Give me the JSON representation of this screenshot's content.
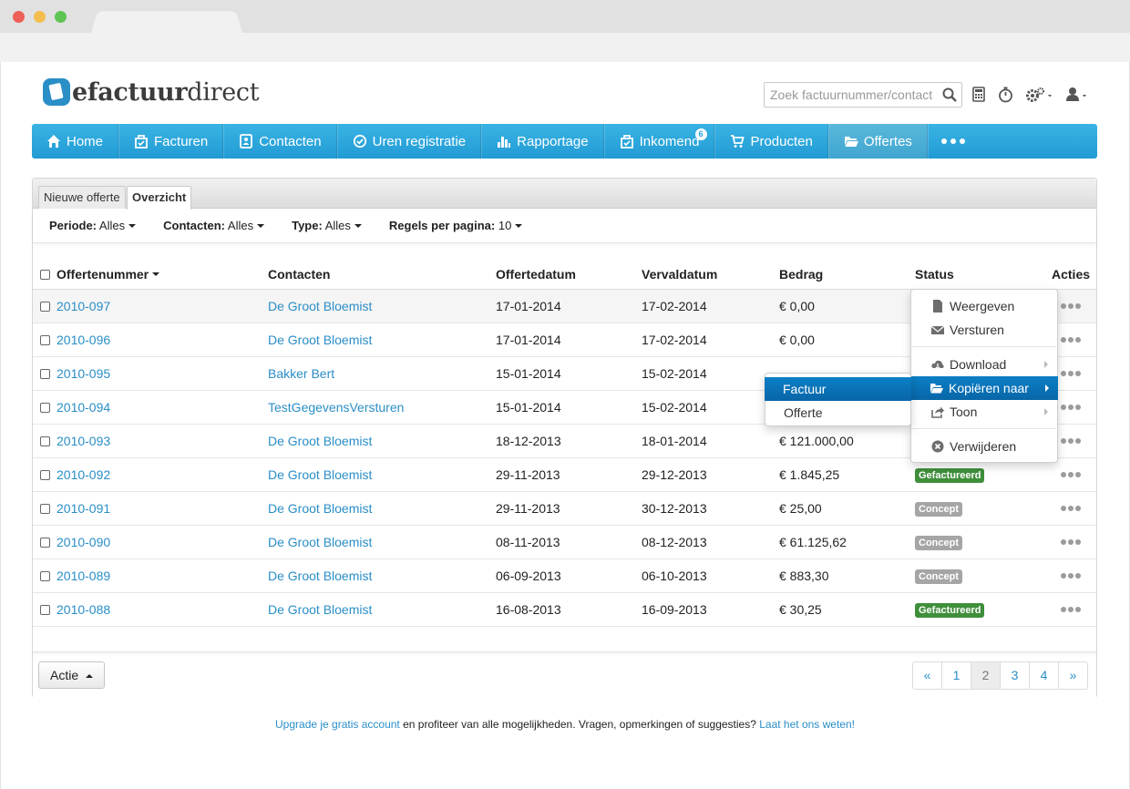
{
  "app": {
    "logo_text_bold": "efactuur",
    "logo_text_light": "direct"
  },
  "header": {
    "search_placeholder": "Zoek factuurnummer/contact",
    "icons": [
      "calculator-icon",
      "stopwatch-icon",
      "settings-icon",
      "user-icon"
    ]
  },
  "nav": {
    "items": [
      {
        "label": "Home",
        "icon": "home-icon"
      },
      {
        "label": "Facturen",
        "icon": "invoice-icon"
      },
      {
        "label": "Contacten",
        "icon": "contacts-icon"
      },
      {
        "label": "Uren registratie",
        "icon": "clock-icon"
      },
      {
        "label": "Rapportage",
        "icon": "bar-chart-icon"
      },
      {
        "label": "Inkomend",
        "icon": "inbox-icon",
        "badge": "6"
      },
      {
        "label": "Producten",
        "icon": "cart-icon"
      },
      {
        "label": "Offertes",
        "icon": "folder-icon",
        "active": true
      }
    ]
  },
  "tabs": {
    "new_quote": "Nieuwe offerte",
    "overview": "Overzicht"
  },
  "filters": {
    "period_label": "Periode:",
    "period_value": "Alles",
    "contacts_label": "Contacten:",
    "contacts_value": "Alles",
    "type_label": "Type:",
    "type_value": "Alles",
    "rows_label": "Regels per pagina:",
    "rows_value": "10"
  },
  "table": {
    "headers": {
      "number": "Offertenummer",
      "contact": "Contacten",
      "date": "Offertedatum",
      "due": "Vervaldatum",
      "amount": "Bedrag",
      "status": "Status",
      "actions": "Acties"
    },
    "rows": [
      {
        "number": "2010-097",
        "contact": "De Groot Bloemist",
        "date": "17-01-2014",
        "due": "17-02-2014",
        "amount": "€ 0,00",
        "status": ""
      },
      {
        "number": "2010-096",
        "contact": "De Groot Bloemist",
        "date": "17-01-2014",
        "due": "17-02-2014",
        "amount": "€ 0,00",
        "status": ""
      },
      {
        "number": "2010-095",
        "contact": "Bakker Bert",
        "date": "15-01-2014",
        "due": "15-02-2014",
        "amount": "",
        "status": ""
      },
      {
        "number": "2010-094",
        "contact": "TestGegevensVersturen",
        "date": "15-01-2014",
        "due": "15-02-2014",
        "amount": "",
        "status": ""
      },
      {
        "number": "2010-093",
        "contact": "De Groot Bloemist",
        "date": "18-12-2013",
        "due": "18-01-2014",
        "amount": "€ 121.000,00",
        "status": ""
      },
      {
        "number": "2010-092",
        "contact": "De Groot Bloemist",
        "date": "29-11-2013",
        "due": "29-12-2013",
        "amount": "€ 1.845,25",
        "status": "Gefactureerd",
        "status_color": "green"
      },
      {
        "number": "2010-091",
        "contact": "De Groot Bloemist",
        "date": "29-11-2013",
        "due": "30-12-2013",
        "amount": "€ 25,00",
        "status": "Concept",
        "status_color": "grey"
      },
      {
        "number": "2010-090",
        "contact": "De Groot Bloemist",
        "date": "08-11-2013",
        "due": "08-12-2013",
        "amount": "€ 61.125,62",
        "status": "Concept",
        "status_color": "grey"
      },
      {
        "number": "2010-089",
        "contact": "De Groot Bloemist",
        "date": "06-09-2013",
        "due": "06-10-2013",
        "amount": "€ 883,30",
        "status": "Concept",
        "status_color": "grey"
      },
      {
        "number": "2010-088",
        "contact": "De Groot Bloemist",
        "date": "16-08-2013",
        "due": "16-09-2013",
        "amount": "€ 30,25",
        "status": "Gefactureerd",
        "status_color": "green"
      }
    ]
  },
  "action_menu": {
    "view": "Weergeven",
    "send": "Versturen",
    "download": "Download",
    "copy_to": "Kopiëren naar",
    "show": "Toon",
    "delete": "Verwijderen"
  },
  "copy_submenu": {
    "invoice": "Factuur",
    "quote": "Offerte"
  },
  "footer_bar": {
    "action_button": "Actie",
    "pages": [
      "«",
      "1",
      "2",
      "3",
      "4",
      "»"
    ],
    "current_page": "2"
  },
  "footer": {
    "upgrade_link": "Upgrade je gratis account",
    "middle_text": " en profiteer van alle mogelijkheden. Vragen, opmerkingen of suggesties? ",
    "contact_link": "Laat het ons weten!"
  },
  "colors": {
    "nav_blue": "#219bd4",
    "link_blue": "#2a8ec7",
    "status_green": "#3f8f3b",
    "status_grey": "#a5a5a5",
    "menu_selected": "#0866a7"
  }
}
